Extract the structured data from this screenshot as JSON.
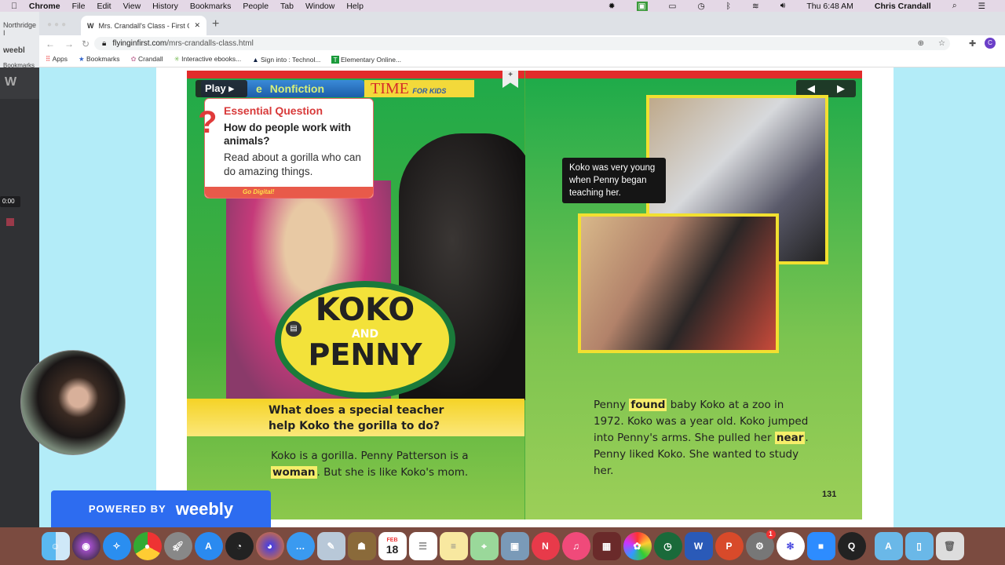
{
  "menubar": {
    "app": "Chrome",
    "items": [
      "File",
      "Edit",
      "View",
      "History",
      "Bookmarks",
      "People",
      "Tab",
      "Window",
      "Help"
    ],
    "clock": "Thu 6:48 AM",
    "user": "Chris Crandall"
  },
  "browser": {
    "bg_tab": "Northridge I",
    "bg_addr": "weebl",
    "bg_bookmarks": "Bookmarks",
    "tab_title": "Mrs. Crandall's Class - First Gr",
    "url_domain": "flyinginfirst.com",
    "url_path": "/mrs-crandalls-class.html",
    "profile": "C",
    "bookmarks": [
      "Apps",
      "Bookmarks",
      "Crandall",
      "Interactive ebooks...",
      "Sign into : Technol...",
      "Elementary Online..."
    ]
  },
  "recorder": {
    "timer": "0:00"
  },
  "book": {
    "play": "Play",
    "genre": "Nonfiction",
    "genre_partial": "e",
    "brand": "TIME",
    "brand_sub": "FOR KIDS",
    "eq_title": "Essential Question",
    "eq_question": "How do people work with animals?",
    "eq_prompt": "Read about a gorilla who can do amazing things.",
    "go_digital": "Go Digital!",
    "logo_top": "KOKO",
    "logo_mid": "AND",
    "logo_bottom": "PENNY",
    "band_question": "What does a special teacher help Koko the gorilla to do?",
    "left_text": {
      "a": "Koko is a gorilla. Penny Patterson is a ",
      "hl": "woman",
      "b": ". But she is like Koko's mom."
    },
    "caption": "Koko was very young when Penny began teaching her.",
    "right_text": {
      "a": "Penny ",
      "hl1": "found",
      "b": " baby Koko at a zoo in 1972. Koko was a year old. Koko jumped into Penny's arms. She pulled her ",
      "hl2": "near",
      "c": ". Penny liked Koko. She wanted to study her."
    },
    "page_number": "131"
  },
  "weebly": {
    "powered": "POWERED BY",
    "brand": "weebly"
  },
  "dock": {
    "calendar_month": "FEB",
    "calendar_day": "18",
    "badge": "1"
  }
}
